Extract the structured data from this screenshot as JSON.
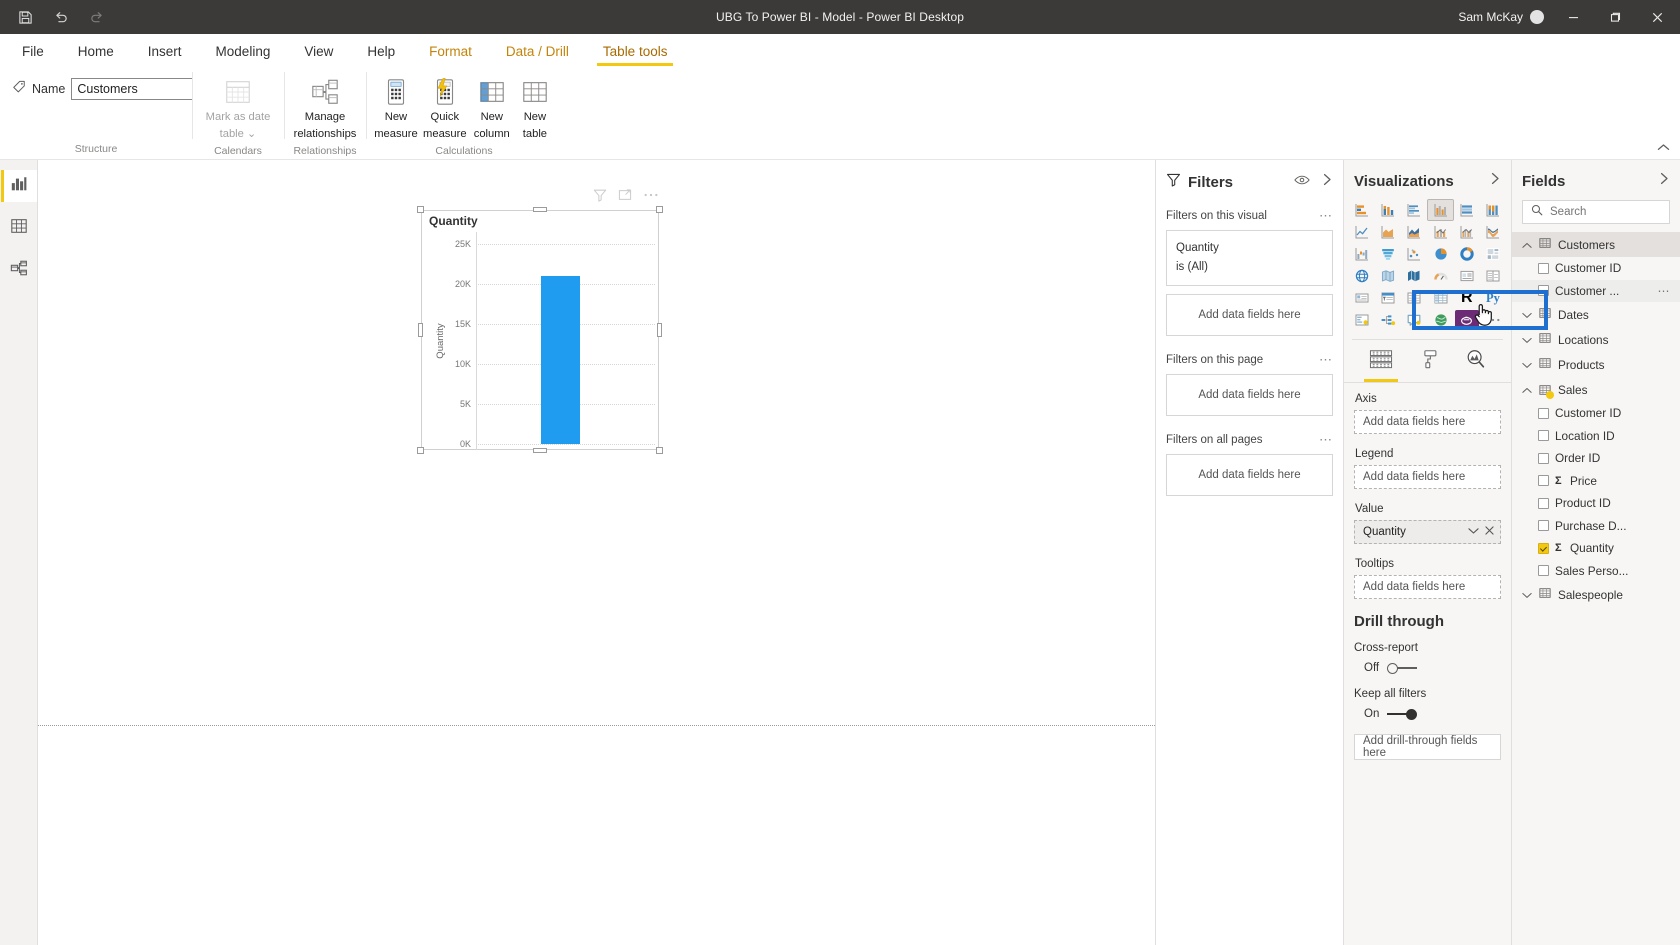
{
  "titlebar": {
    "title": "UBG To Power BI - Model - Power BI Desktop",
    "user": "Sam McKay",
    "save_icon": "save-icon",
    "undo_icon": "undo-icon",
    "redo_icon": "redo-icon",
    "minimize": "–",
    "maximize": "❐",
    "close": "✕"
  },
  "ribbon": {
    "tabs": [
      {
        "label": "File",
        "state": "normal"
      },
      {
        "label": "Home",
        "state": "normal"
      },
      {
        "label": "Insert",
        "state": "normal"
      },
      {
        "label": "Modeling",
        "state": "normal"
      },
      {
        "label": "View",
        "state": "normal"
      },
      {
        "label": "Help",
        "state": "normal"
      },
      {
        "label": "Format",
        "state": "context"
      },
      {
        "label": "Data / Drill",
        "state": "context"
      },
      {
        "label": "Table tools",
        "state": "active"
      }
    ],
    "name_label": "Name",
    "name_value": "Customers",
    "groups": [
      {
        "label": "Structure"
      },
      {
        "label": "Calendars"
      },
      {
        "label": "Relationships"
      },
      {
        "label": "Calculations"
      }
    ],
    "buttons": {
      "mark_as_date_table": "Mark as date\ntable",
      "mark_as_date_table_l1": "Mark as date",
      "mark_as_date_table_l2": "table",
      "manage_relationships_l1": "Manage",
      "manage_relationships_l2": "relationships",
      "new_measure_l1": "New",
      "new_measure_l2": "measure",
      "quick_measure_l1": "Quick",
      "quick_measure_l2": "measure",
      "new_column_l1": "New",
      "new_column_l2": "column",
      "new_table_l1": "New",
      "new_table_l2": "table"
    }
  },
  "leftnav": {
    "items": [
      {
        "name": "report-view",
        "icon": "bar-chart-icon",
        "active": true
      },
      {
        "name": "data-view",
        "icon": "table-grid-icon",
        "active": false
      },
      {
        "name": "model-view",
        "icon": "relationships-icon",
        "active": false
      }
    ]
  },
  "canvas": {
    "visual_header_icons": [
      "filter-icon",
      "focus-mode-icon",
      "more-options-icon"
    ]
  },
  "chart_data": {
    "type": "bar",
    "title": "Quantity",
    "categories": [
      ""
    ],
    "values": [
      21000
    ],
    "xlabel": "",
    "ylabel": "Quantity",
    "ylim": [
      0,
      25000
    ],
    "yticks": [
      "0K",
      "5K",
      "10K",
      "15K",
      "20K",
      "25K"
    ],
    "ytick_values": [
      0,
      5000,
      10000,
      15000,
      20000,
      25000
    ],
    "grid": true,
    "legend": "none",
    "bar_color": "#1f9bf0"
  },
  "filters": {
    "title": "Filters",
    "eye_icon": "eye-icon",
    "expand_icon": "chevron-right-icon",
    "funnel_icon": "funnel-icon",
    "sections": [
      {
        "title": "Filters on this visual",
        "dots": "⋯",
        "cards": [
          {
            "field": "Quantity",
            "condition": "is (All)"
          }
        ],
        "drop_label": "Add data fields here"
      },
      {
        "title": "Filters on this page",
        "dots": "⋯",
        "cards": [],
        "drop_label": "Add data fields here"
      },
      {
        "title": "Filters on all pages",
        "dots": "⋯",
        "cards": [],
        "drop_label": "Add data fields here"
      }
    ]
  },
  "visualizations": {
    "title": "Visualizations",
    "expand_icon": "chevron-right-icon",
    "gallery": [
      {
        "name": "stacked-bar-chart",
        "selected": false
      },
      {
        "name": "stacked-column-chart",
        "selected": false
      },
      {
        "name": "clustered-bar-chart",
        "selected": false
      },
      {
        "name": "clustered-column-chart",
        "selected": true
      },
      {
        "name": "100-percent-stacked-bar-chart",
        "selected": false
      },
      {
        "name": "100-percent-stacked-column-chart",
        "selected": false
      },
      {
        "name": "line-chart",
        "selected": false
      },
      {
        "name": "area-chart",
        "selected": false
      },
      {
        "name": "stacked-area-chart",
        "selected": false
      },
      {
        "name": "line-stacked-column-chart",
        "selected": false
      },
      {
        "name": "line-clustered-column-chart",
        "selected": false
      },
      {
        "name": "ribbon-chart",
        "selected": false
      },
      {
        "name": "waterfall-chart",
        "selected": false
      },
      {
        "name": "funnel-chart",
        "selected": false
      },
      {
        "name": "scatter-chart",
        "selected": false
      },
      {
        "name": "pie-chart",
        "selected": false
      },
      {
        "name": "donut-chart",
        "selected": false
      },
      {
        "name": "treemap-chart",
        "selected": false
      },
      {
        "name": "map-chart",
        "selected": false
      },
      {
        "name": "filled-map-chart",
        "selected": false
      },
      {
        "name": "shape-map-chart",
        "selected": false
      },
      {
        "name": "gauge-chart",
        "selected": false
      },
      {
        "name": "card-visual",
        "selected": false
      },
      {
        "name": "multi-row-card-visual",
        "selected": false
      },
      {
        "name": "kpi-visual",
        "selected": false
      },
      {
        "name": "slicer-visual",
        "selected": false
      },
      {
        "name": "table-visual",
        "selected": false
      },
      {
        "name": "matrix-visual",
        "selected": false
      },
      {
        "name": "r-script-visual",
        "selected": false
      },
      {
        "name": "python-visual",
        "selected": false
      },
      {
        "name": "key-influencers-visual",
        "selected": false
      },
      {
        "name": "decomposition-tree-visual",
        "selected": false
      },
      {
        "name": "qna-visual",
        "selected": false
      },
      {
        "name": "arcgis-maps-visual",
        "selected": false
      },
      {
        "name": "paginated-report-visual",
        "selected": false
      },
      {
        "name": "more-visuals",
        "selected": false
      }
    ],
    "tabs": [
      {
        "name": "fields-tab",
        "icon": "fields-stack-icon",
        "active": true
      },
      {
        "name": "format-tab",
        "icon": "paint-roller-icon",
        "active": false
      },
      {
        "name": "analytics-tab",
        "icon": "magnifier-chart-icon",
        "active": false
      }
    ],
    "wells": [
      {
        "label": "Axis",
        "value": null,
        "placeholder": "Add data fields here"
      },
      {
        "label": "Legend",
        "value": null,
        "placeholder": "Add data fields here"
      },
      {
        "label": "Value",
        "value": "Quantity",
        "placeholder": null
      },
      {
        "label": "Tooltips",
        "value": null,
        "placeholder": "Add data fields here"
      }
    ],
    "drill_through": {
      "title": "Drill through",
      "cross_report_label": "Cross-report",
      "cross_report_state": "Off",
      "keep_all_filters_label": "Keep all filters",
      "keep_all_filters_state": "On",
      "drop_label": "Add drill-through fields here"
    }
  },
  "fields": {
    "title": "Fields",
    "expand_icon": "chevron-right-icon",
    "search_placeholder": "Search",
    "search_value": "",
    "tables": [
      {
        "name": "Customers",
        "expanded": true,
        "selected": true,
        "fields": [
          {
            "label": "Customer ID",
            "checked": false,
            "aggregate": false
          },
          {
            "label": "Customer ...",
            "checked": false,
            "aggregate": false,
            "hovered": true,
            "highlighted": true
          }
        ]
      },
      {
        "name": "Dates",
        "expanded": false,
        "selected": false,
        "fields": []
      },
      {
        "name": "Locations",
        "expanded": false,
        "selected": false,
        "fields": []
      },
      {
        "name": "Products",
        "expanded": false,
        "selected": false,
        "fields": []
      },
      {
        "name": "Sales",
        "expanded": true,
        "selected": false,
        "badge": "calculation-badge",
        "fields": [
          {
            "label": "Customer ID",
            "checked": false,
            "aggregate": false
          },
          {
            "label": "Location ID",
            "checked": false,
            "aggregate": false
          },
          {
            "label": "Order ID",
            "checked": false,
            "aggregate": false
          },
          {
            "label": "Price",
            "checked": false,
            "aggregate": true
          },
          {
            "label": "Product ID",
            "checked": false,
            "aggregate": false
          },
          {
            "label": "Purchase D...",
            "checked": false,
            "aggregate": false
          },
          {
            "label": "Quantity",
            "checked": true,
            "aggregate": true
          },
          {
            "label": "Sales Perso...",
            "checked": false,
            "aggregate": false
          }
        ]
      },
      {
        "name": "Salespeople",
        "expanded": false,
        "selected": false,
        "fields": []
      }
    ]
  },
  "colors": {
    "accent": "#f2c811",
    "bar": "#1f9bf0",
    "highlight_box": "#1f6fd0",
    "titlebar_bg": "#3b3a39",
    "pane_bg": "#f7f6f5"
  }
}
